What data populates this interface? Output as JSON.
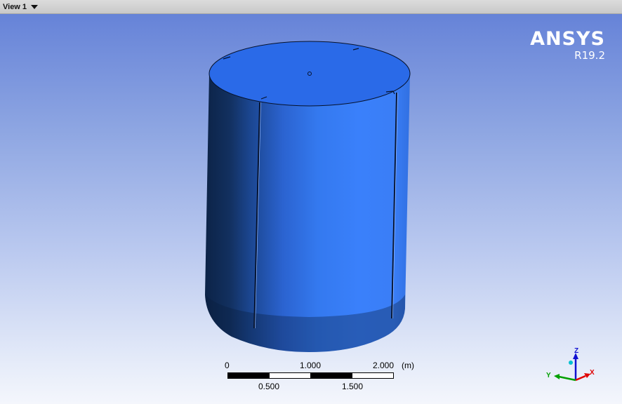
{
  "titlebar": {
    "view_title": "View 1",
    "dropdown_icon": "caret-down-icon"
  },
  "brand": {
    "name": "ANSYS",
    "version": "R19.2"
  },
  "scale_bar": {
    "top_labels": [
      "0",
      "1.000",
      "2.000"
    ],
    "unit": "(m)",
    "bottom_labels": [
      "0.500",
      "1.500"
    ]
  },
  "triad": {
    "x_label": "X",
    "y_label": "Y",
    "z_label": "Z",
    "colors": {
      "x": "#e00000",
      "y": "#00a000",
      "z": "#1010d0",
      "iso": "#00c0d0"
    }
  },
  "model": {
    "shape": "cylinder",
    "colors": {
      "top": "#2a6ae8",
      "side_light": "#3a7ef5",
      "side_dark": "#0f2b5c"
    }
  }
}
